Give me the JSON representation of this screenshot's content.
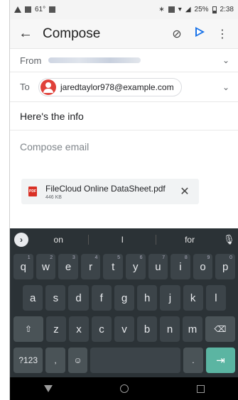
{
  "status_bar": {
    "temperature": "61°",
    "battery_percent": "25%",
    "time": "2:38"
  },
  "app_bar": {
    "title": "Compose"
  },
  "from": {
    "label": "From"
  },
  "to": {
    "label": "To",
    "recipient": "jaredtaylor978@example.com"
  },
  "subject": "Here's the info",
  "body_placeholder": "Compose email",
  "attachment": {
    "name": "FileCloud Online DataSheet.pdf",
    "size": "446 KB",
    "badge": "PDF"
  },
  "keyboard": {
    "suggestions": [
      "on",
      "I",
      "for"
    ],
    "row1": [
      {
        "k": "q",
        "s": "1"
      },
      {
        "k": "w",
        "s": "2"
      },
      {
        "k": "e",
        "s": "3"
      },
      {
        "k": "r",
        "s": "4"
      },
      {
        "k": "t",
        "s": "5"
      },
      {
        "k": "y",
        "s": "6"
      },
      {
        "k": "u",
        "s": "7"
      },
      {
        "k": "i",
        "s": "8"
      },
      {
        "k": "o",
        "s": "9"
      },
      {
        "k": "p",
        "s": "0"
      }
    ],
    "row2": [
      "a",
      "s",
      "d",
      "f",
      "g",
      "h",
      "j",
      "k",
      "l"
    ],
    "row3": [
      "z",
      "x",
      "c",
      "v",
      "b",
      "n",
      "m"
    ],
    "symbols_key": "?123",
    "comma_key": ",",
    "period_key": "."
  },
  "colors": {
    "accent": "#1a73e8",
    "keyboard_bg": "#2b3236",
    "enter_key": "#5bb5a2",
    "avatar": "#e0413a"
  }
}
